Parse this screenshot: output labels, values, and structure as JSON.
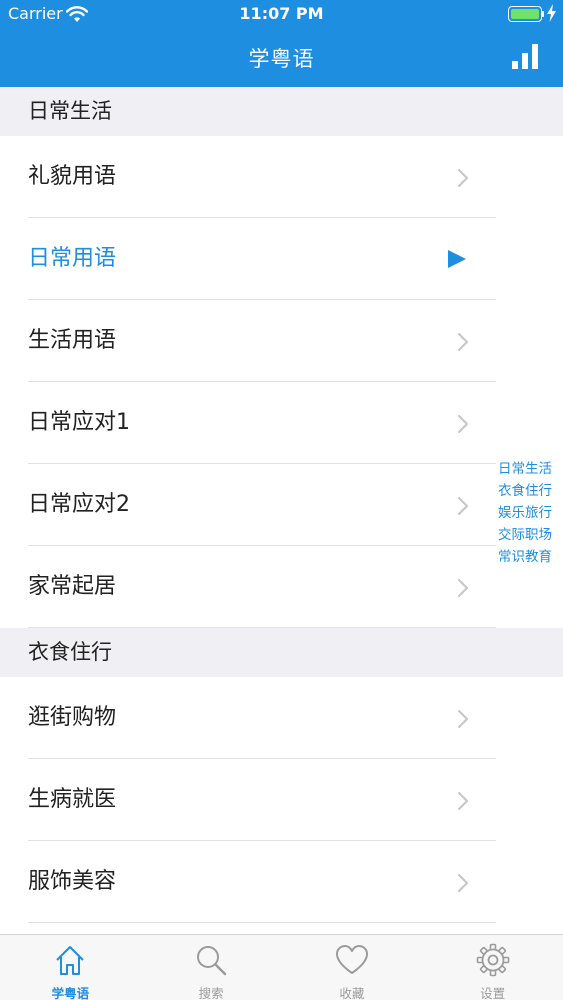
{
  "status": {
    "carrier": "Carrier",
    "time": "11:07 PM"
  },
  "nav": {
    "title": "学粤语",
    "right_icon": "signal-bars-icon"
  },
  "colors": {
    "accent": "#1d8ee0",
    "section_bg": "#efeff4",
    "battery": "#6ee26a"
  },
  "sections": [
    {
      "title": "日常生活",
      "items": [
        {
          "label": "礼貌用语",
          "state": "normal"
        },
        {
          "label": "日常用语",
          "state": "playing"
        },
        {
          "label": "生活用语",
          "state": "normal"
        },
        {
          "label": "日常应对1",
          "state": "normal"
        },
        {
          "label": "日常应对2",
          "state": "normal"
        },
        {
          "label": "家常起居",
          "state": "normal"
        }
      ]
    },
    {
      "title": "衣食住行",
      "items": [
        {
          "label": "逛街购物",
          "state": "normal"
        },
        {
          "label": "生病就医",
          "state": "normal"
        },
        {
          "label": "服饰美容",
          "state": "normal"
        }
      ]
    }
  ],
  "index": [
    "日常生活",
    "衣食住行",
    "娱乐旅行",
    "交际职场",
    "常识教育"
  ],
  "tabs": [
    {
      "label": "学粤语",
      "icon": "home-icon",
      "active": true
    },
    {
      "label": "搜索",
      "icon": "search-icon",
      "active": false
    },
    {
      "label": "收藏",
      "icon": "heart-icon",
      "active": false
    },
    {
      "label": "设置",
      "icon": "gear-icon",
      "active": false
    }
  ]
}
